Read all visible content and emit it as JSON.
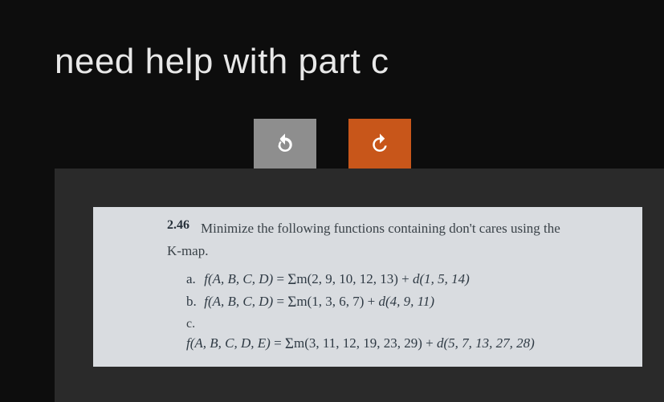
{
  "title": "need help with part c",
  "buttons": {
    "undo_icon": "undo-icon",
    "redo_icon": "redo-icon"
  },
  "problem": {
    "number": "2.46",
    "heading": "Minimize the following functions containing don't cares using the",
    "kmap_line": "K-map.",
    "items": {
      "a": {
        "label": "a.",
        "fn": "f(A, B, C, D)",
        "eq": "=",
        "sum": "∑m(2, 9, 10, 12, 13)",
        "plus": "+",
        "dc": "d(1, 5, 14)"
      },
      "b": {
        "label": "b.",
        "fn": "f(A, B, C, D)",
        "eq": "=",
        "sum": "∑m(1, 3, 6, 7)",
        "plus": "+",
        "dc": "d(4, 9, 11)"
      },
      "c": {
        "label": "c.",
        "fn": "f(A, B, C, D, E)",
        "eq": "=",
        "sum": "∑m(3, 11, 12, 19, 23, 29)",
        "plus": "+",
        "dc": "d(5, 7, 13, 27, 28)"
      }
    }
  }
}
